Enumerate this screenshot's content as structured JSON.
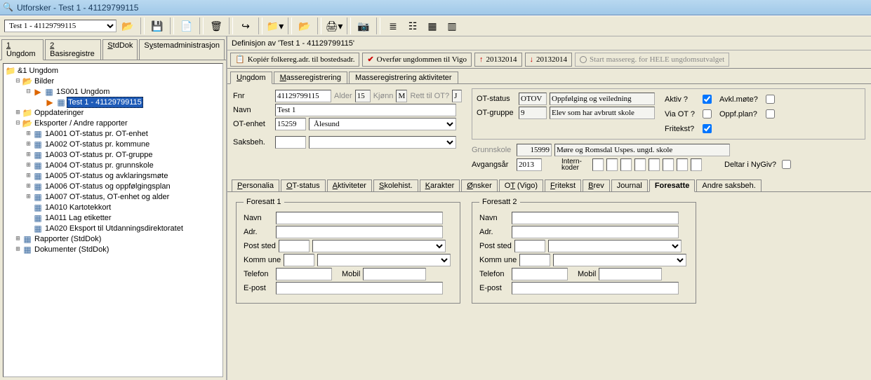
{
  "window": {
    "title": "Utforsker - Test 1 - 41129799115"
  },
  "toolbar": {
    "combo_value": "Test 1 - 41129799115"
  },
  "left_tabs": [
    "1 Ungdom",
    "2 Basisregistre",
    "StdDok",
    "Systemadministrasjon"
  ],
  "left_tabs_active": 0,
  "tree": {
    "root": "&1 Ungdom",
    "bilder": "Bilder",
    "s001": "1S001 Ungdom",
    "selected": "Test 1 - 41129799115",
    "oppdateringer": "Oppdateringer",
    "eksporter": "Eksporter / Andre rapporter",
    "items": [
      "1A001 OT-status pr. OT-enhet",
      "1A002 OT-status pr. kommune",
      "1A003 OT-status pr. OT-gruppe",
      "1A004 OT-status pr. grunnskole",
      "1A005 OT-status og avklaringsmøte",
      "1A006 OT-status og oppfølgingsplan",
      "1A007 OT-status, OT-enhet og alder",
      "1A010 Kartotekkort",
      "1A011 Lag etiketter",
      "1A020 Eksport til Utdanningsdirektoratet"
    ],
    "rapporter": "Rapporter (StdDok)",
    "dokumenter": "Dokumenter (StdDok)"
  },
  "def_bar": "Definisjon av 'Test 1 - 41129799115'",
  "actions": {
    "a1": "Kopiér folkereg.adr. til bostedsadr.",
    "a2": "Overfør ungdommen til Vigo",
    "a3": "20132014",
    "a4": "20132014",
    "a5": "Start massereg. for HELE ungdomsutvalget"
  },
  "right_tabs": [
    "Ungdom",
    "Masseregistrering",
    "Masseregistrering aktiviteter"
  ],
  "right_tabs_active": 0,
  "form": {
    "fnr_label": "Fnr",
    "fnr": "41129799115",
    "alder_label": "Alder",
    "alder": "15",
    "kjonn_label": "Kjønn",
    "kjonn": "M",
    "rett_label": "Rett til OT?",
    "rett": "J",
    "navn_label": "Navn",
    "navn": "Test 1",
    "otenhet_label": "OT-enhet",
    "otenhet_kode": "15259",
    "otenhet_navn": "Ålesund",
    "saksbeh_label": "Saksbeh.",
    "saksbeh_kode": "",
    "saksbeh_navn": "",
    "otstatus_label": "OT-status",
    "otstatus_kode": "OTOV",
    "otstatus_navn": "Oppfølging og veiledning",
    "otgruppe_label": "OT-gruppe",
    "otgruppe_kode": "9",
    "otgruppe_navn": "Elev som har avbrutt skole",
    "grunnskole_label": "Grunnskole",
    "grunnskole_kode": "15999",
    "grunnskole_navn": "Møre og Romsdal Uspes. ungd. skole",
    "avgangs_label": "Avgangsår",
    "avgangs": "2013",
    "internkoder_label": "Intern-koder",
    "aktiv": "Aktiv ?",
    "viaot": "Via OT ?",
    "fritekst": "Fritekst?",
    "avklmote": "Avkl.møte?",
    "oppfplan": "Oppf.plan?",
    "deltar": "Deltar i NyGiv?"
  },
  "lower_tabs": [
    "Personalia",
    "OT-status",
    "Aktiviteter",
    "Skolehist.",
    "Karakter",
    "Ønsker",
    "OT (Vigo)",
    "Fritekst",
    "Brev",
    "Journal",
    "Foresatte",
    "Andre saksbeh."
  ],
  "lower_tabs_active": 10,
  "foresatt": {
    "legend1": "Foresatt 1",
    "legend2": "Foresatt 2",
    "navn": "Navn",
    "adr": "Adr.",
    "poststed": "Post sted",
    "kommune": "Komm une",
    "telefon": "Telefon",
    "mobil": "Mobil",
    "epost": "E-post"
  }
}
